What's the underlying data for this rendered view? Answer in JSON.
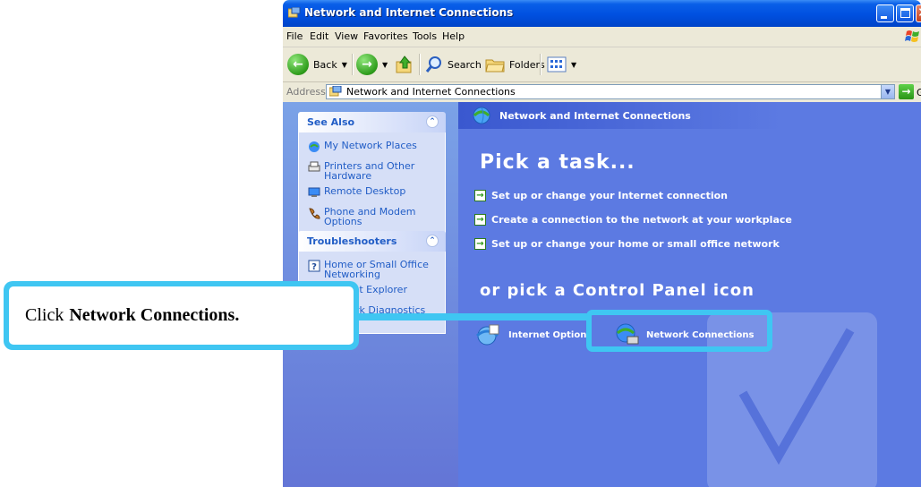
{
  "window": {
    "title": "Network and Internet Connections",
    "menu": [
      "File",
      "Edit",
      "View",
      "Favorites",
      "Tools",
      "Help"
    ],
    "toolbar": {
      "back_label": "Back",
      "search_label": "Search",
      "folders_label": "Folders"
    },
    "address": {
      "label": "Address",
      "value": "Network and Internet Connections",
      "go_label": "Go"
    }
  },
  "sidebar": {
    "see_also": {
      "title": "See Also",
      "items": [
        {
          "label": "My Network Places",
          "icon": "network-places-icon"
        },
        {
          "label": "Printers and Other Hardware",
          "icon": "printer-icon"
        },
        {
          "label": "Remote Desktop",
          "icon": "remote-desktop-icon"
        },
        {
          "label": "Phone and Modem Options",
          "icon": "phone-modem-icon"
        }
      ]
    },
    "troubleshooters": {
      "title": "Troubleshooters",
      "items": [
        {
          "label": "Home or Small Office Networking",
          "icon": "help-icon"
        },
        {
          "label": "Internet Explorer",
          "icon": "help-icon"
        },
        {
          "label": "Network Diagnostics",
          "icon": "help-icon"
        }
      ]
    }
  },
  "main": {
    "header": "Network and Internet Connections",
    "pick_task": "Pick a task...",
    "tasks": [
      "Set up or change your Internet connection",
      "Create a connection to the network at your workplace",
      "Set up or change your home or small office network"
    ],
    "pick_icon": "or pick a Control Panel icon",
    "icons": [
      {
        "label": "Internet Options",
        "icon": "internet-options-icon"
      },
      {
        "label": "Network Connections",
        "icon": "network-connections-icon"
      }
    ]
  },
  "callout": {
    "prefix": "Click",
    "bold": "Network Connections."
  },
  "colors": {
    "titlebar": "#0054e3",
    "pane": "#5c7ae2",
    "callout": "#3fc6f2",
    "link": "#215dc6"
  }
}
